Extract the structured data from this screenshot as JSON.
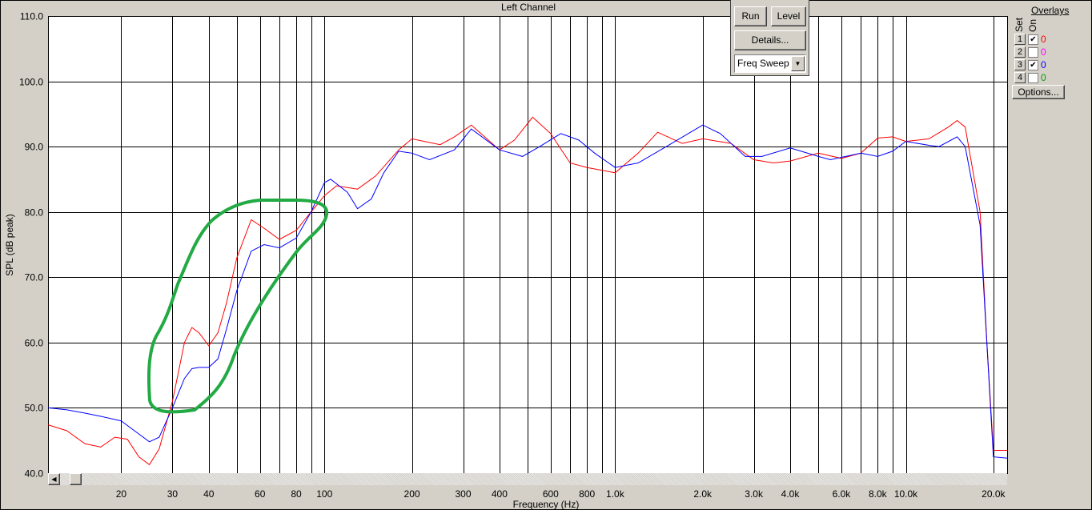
{
  "window": {
    "title": "Left Channel"
  },
  "controls": {
    "run": "Run",
    "level": "Level",
    "details": "Details...",
    "mode": "Freq Sweep",
    "options": "Options..."
  },
  "overlays": {
    "title": "Overlays",
    "set_label": "Set",
    "on_label": "On",
    "rows": [
      {
        "set": "1",
        "on": true,
        "count": "0",
        "color": "#ff0000"
      },
      {
        "set": "2",
        "on": false,
        "count": "0",
        "color": "#ff00ff"
      },
      {
        "set": "3",
        "on": true,
        "count": "0",
        "color": "#0000ff"
      },
      {
        "set": "4",
        "on": false,
        "count": "0",
        "color": "#00a000"
      }
    ]
  },
  "chart_data": {
    "type": "line",
    "title": "Left Channel",
    "xlabel": "Frequency (Hz)",
    "ylabel": "SPL (dB peak)",
    "xscale": "log",
    "xlim": [
      11.2,
      22300
    ],
    "ylim": [
      40,
      110
    ],
    "grid": true,
    "yticks": [
      40,
      50,
      60,
      70,
      80,
      90,
      100,
      110
    ],
    "ytick_labels": [
      "40.0",
      "50.0",
      "60.0",
      "70.0",
      "80.0",
      "90.0",
      "100.0",
      "110.0"
    ],
    "xticks": [
      20,
      30,
      40,
      50,
      60,
      70,
      80,
      90,
      100,
      200,
      300,
      400,
      500,
      600,
      700,
      800,
      900,
      1000,
      2000,
      3000,
      4000,
      5000,
      6000,
      7000,
      8000,
      9000,
      10000,
      20000
    ],
    "xtick_labels": [
      {
        "f": 20,
        "t": "20"
      },
      {
        "f": 30,
        "t": "30"
      },
      {
        "f": 40,
        "t": "40"
      },
      {
        "f": 60,
        "t": "60"
      },
      {
        "f": 80,
        "t": "80"
      },
      {
        "f": 100,
        "t": "100"
      },
      {
        "f": 200,
        "t": "200"
      },
      {
        "f": 300,
        "t": "300"
      },
      {
        "f": 400,
        "t": "400"
      },
      {
        "f": 600,
        "t": "600"
      },
      {
        "f": 800,
        "t": "800"
      },
      {
        "f": 1000,
        "t": "1.0k"
      },
      {
        "f": 2000,
        "t": "2.0k"
      },
      {
        "f": 3000,
        "t": "3.0k"
      },
      {
        "f": 4000,
        "t": "4.0k"
      },
      {
        "f": 6000,
        "t": "6.0k"
      },
      {
        "f": 8000,
        "t": "8.0k"
      },
      {
        "f": 10000,
        "t": "10.0k"
      },
      {
        "f": 20000,
        "t": "20.0k"
      }
    ],
    "series": [
      {
        "name": "Set 1",
        "color": "#ff0000",
        "points": [
          [
            11.2,
            47.4
          ],
          [
            13,
            46.5
          ],
          [
            15,
            44.5
          ],
          [
            17,
            44
          ],
          [
            19,
            45.5
          ],
          [
            21,
            45.2
          ],
          [
            23,
            42.5
          ],
          [
            25,
            41.3
          ],
          [
            27,
            43.7
          ],
          [
            30,
            51
          ],
          [
            33,
            60
          ],
          [
            35,
            62.3
          ],
          [
            37,
            61.5
          ],
          [
            40,
            59.5
          ],
          [
            43,
            61.5
          ],
          [
            46,
            66
          ],
          [
            50,
            73
          ],
          [
            56,
            78.8
          ],
          [
            62,
            77.5
          ],
          [
            70,
            75.8
          ],
          [
            80,
            77.2
          ],
          [
            90,
            80
          ],
          [
            100,
            82.5
          ],
          [
            110,
            84
          ],
          [
            130,
            83.5
          ],
          [
            150,
            85.5
          ],
          [
            180,
            89.5
          ],
          [
            200,
            91.2
          ],
          [
            250,
            90.3
          ],
          [
            280,
            91.5
          ],
          [
            320,
            93.3
          ],
          [
            400,
            89.5
          ],
          [
            450,
            91
          ],
          [
            520,
            94.5
          ],
          [
            600,
            92
          ],
          [
            700,
            87.5
          ],
          [
            800,
            86.8
          ],
          [
            1000,
            86
          ],
          [
            1200,
            89
          ],
          [
            1400,
            92.2
          ],
          [
            1700,
            90.5
          ],
          [
            2000,
            91.2
          ],
          [
            2500,
            90.5
          ],
          [
            3000,
            88
          ],
          [
            3500,
            87.5
          ],
          [
            4000,
            87.8
          ],
          [
            5000,
            89
          ],
          [
            6000,
            88.2
          ],
          [
            7000,
            89
          ],
          [
            8000,
            91.3
          ],
          [
            9000,
            91.5
          ],
          [
            10000,
            90.8
          ],
          [
            12000,
            91.2
          ],
          [
            14000,
            93
          ],
          [
            15000,
            94
          ],
          [
            16000,
            93
          ],
          [
            18000,
            80
          ],
          [
            19000,
            60
          ],
          [
            20000,
            43.5
          ],
          [
            22300,
            43.5
          ]
        ]
      },
      {
        "name": "Set 3",
        "color": "#0000ff",
        "points": [
          [
            11.2,
            50
          ],
          [
            13,
            49.7
          ],
          [
            15,
            49.2
          ],
          [
            17,
            48.7
          ],
          [
            20,
            48
          ],
          [
            23,
            46
          ],
          [
            25,
            44.8
          ],
          [
            27,
            45.5
          ],
          [
            30,
            50
          ],
          [
            33,
            54.5
          ],
          [
            35,
            56
          ],
          [
            37,
            56.2
          ],
          [
            40,
            56.2
          ],
          [
            43,
            57.5
          ],
          [
            46,
            62
          ],
          [
            50,
            68
          ],
          [
            56,
            74
          ],
          [
            62,
            75
          ],
          [
            70,
            74.5
          ],
          [
            80,
            76
          ],
          [
            90,
            80
          ],
          [
            100,
            84.5
          ],
          [
            105,
            85
          ],
          [
            120,
            83
          ],
          [
            130,
            80.5
          ],
          [
            145,
            82
          ],
          [
            160,
            86
          ],
          [
            180,
            89.3
          ],
          [
            200,
            89
          ],
          [
            230,
            88
          ],
          [
            280,
            89.5
          ],
          [
            320,
            92.7
          ],
          [
            400,
            89.5
          ],
          [
            480,
            88.5
          ],
          [
            550,
            90
          ],
          [
            650,
            92
          ],
          [
            750,
            91
          ],
          [
            850,
            89
          ],
          [
            1000,
            86.8
          ],
          [
            1200,
            87.5
          ],
          [
            1500,
            90
          ],
          [
            2000,
            93.3
          ],
          [
            2300,
            92
          ],
          [
            2800,
            88.5
          ],
          [
            3200,
            88.5
          ],
          [
            4000,
            89.8
          ],
          [
            5000,
            88.5
          ],
          [
            5500,
            88
          ],
          [
            7000,
            89
          ],
          [
            8000,
            88.5
          ],
          [
            9000,
            89.3
          ],
          [
            10000,
            90.8
          ],
          [
            12000,
            90.2
          ],
          [
            13000,
            90
          ],
          [
            15000,
            91.5
          ],
          [
            16000,
            90
          ],
          [
            18000,
            78
          ],
          [
            20000,
            42.5
          ],
          [
            22300,
            42.3
          ]
        ]
      }
    ],
    "annotation": {
      "color": "#22aa44"
    }
  }
}
